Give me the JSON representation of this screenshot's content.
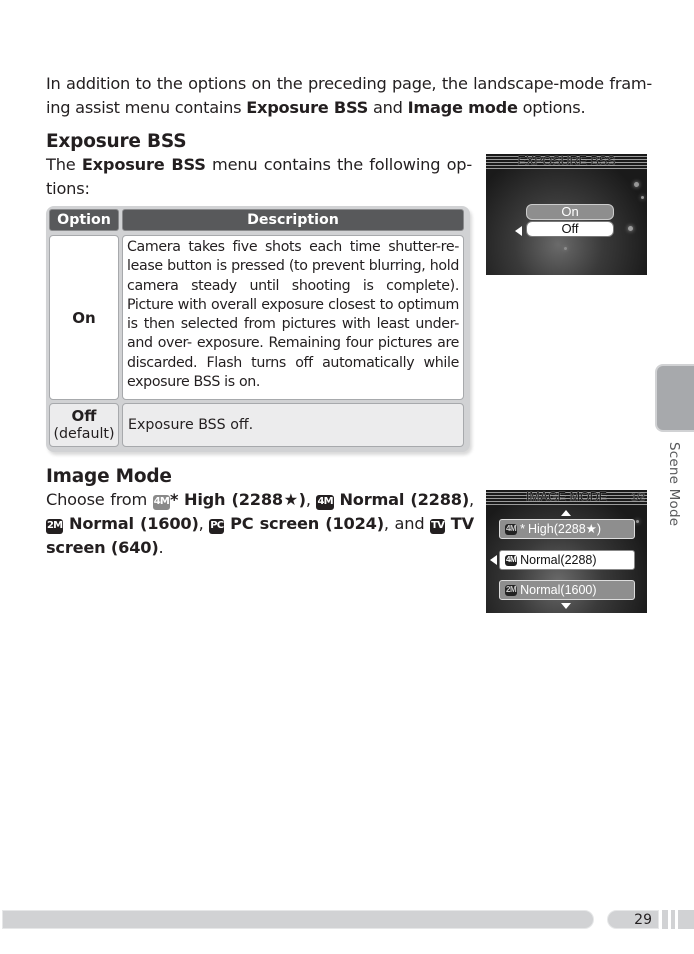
{
  "intro": {
    "text_1": "In addition to the options on the preceding page, the landscape-mode fram-ing assist menu contains ",
    "bold_1": "Exposure BSS",
    "text_2": " and ",
    "bold_2": "Image mode",
    "text_3": " options."
  },
  "exposure_bss": {
    "heading": "Exposure BSS",
    "para_1": "The ",
    "para_bold": "Exposure BSS",
    "para_2": " menu contains the following op-tions:",
    "table": {
      "headers": [
        "Option",
        "Description"
      ],
      "rows": [
        {
          "option": "On",
          "option_note": "",
          "description": "Camera takes five shots each time shutter-re-lease button is pressed (to prevent blurring, hold camera steady until shooting is complete). Picture with overall exposure closest to optimum is then selected from pictures with least under- and over- exposure.  Remaining four pictures are discarded.  Flash turns off automatically while exposure BSS is on."
        },
        {
          "option": "Off",
          "option_note": "(default)",
          "description": "Exposure BSS off."
        }
      ]
    },
    "screen": {
      "title": "EXPOSURE BSS",
      "options": [
        "On",
        "Off"
      ],
      "selected": "Off"
    }
  },
  "image_mode": {
    "heading": "Image Mode",
    "choose": "Choose from ",
    "items": [
      {
        "icon": "4M",
        "star": "*",
        "label": "High (2288★)"
      },
      {
        "icon": "4M",
        "label": "Normal (2288)"
      },
      {
        "icon": "2M",
        "label": "Normal (1600)"
      },
      {
        "icon": "PC",
        "label": "PC screen (1024)"
      },
      {
        "icon": "TV",
        "label": "TV screen (640)"
      }
    ],
    "sep": ", ",
    "and": ", and ",
    "end": ".",
    "screen": {
      "title": "IMAGE MODE",
      "page": "1/2",
      "rows": [
        {
          "icon": "4M",
          "star": "*",
          "label": "High(2288★)"
        },
        {
          "icon": "4M",
          "label": "Normal(2288)"
        },
        {
          "icon": "2M",
          "label": "Normal(1600)"
        }
      ],
      "selected": "Normal(2288)"
    }
  },
  "side_tab": {
    "label": "Scene Mode"
  },
  "footer": {
    "page_number": "29"
  }
}
